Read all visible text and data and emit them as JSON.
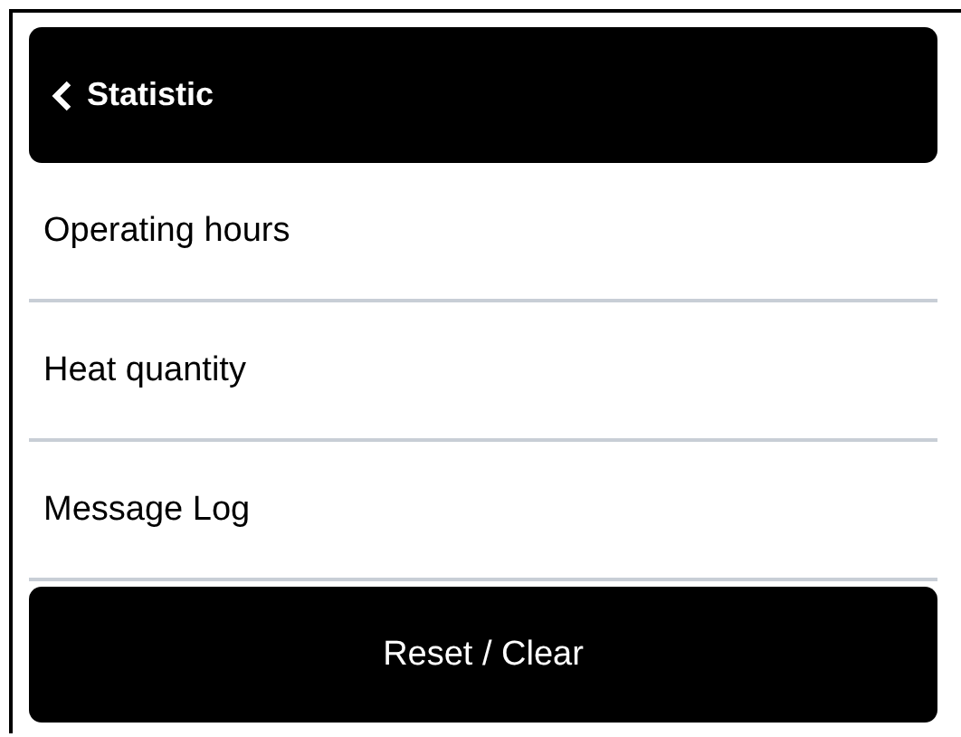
{
  "header": {
    "title": "Statistic"
  },
  "items": [
    {
      "label": "Operating hours"
    },
    {
      "label": "Heat quantity"
    },
    {
      "label": "Message Log"
    }
  ],
  "button": {
    "label": "Reset / Clear"
  }
}
